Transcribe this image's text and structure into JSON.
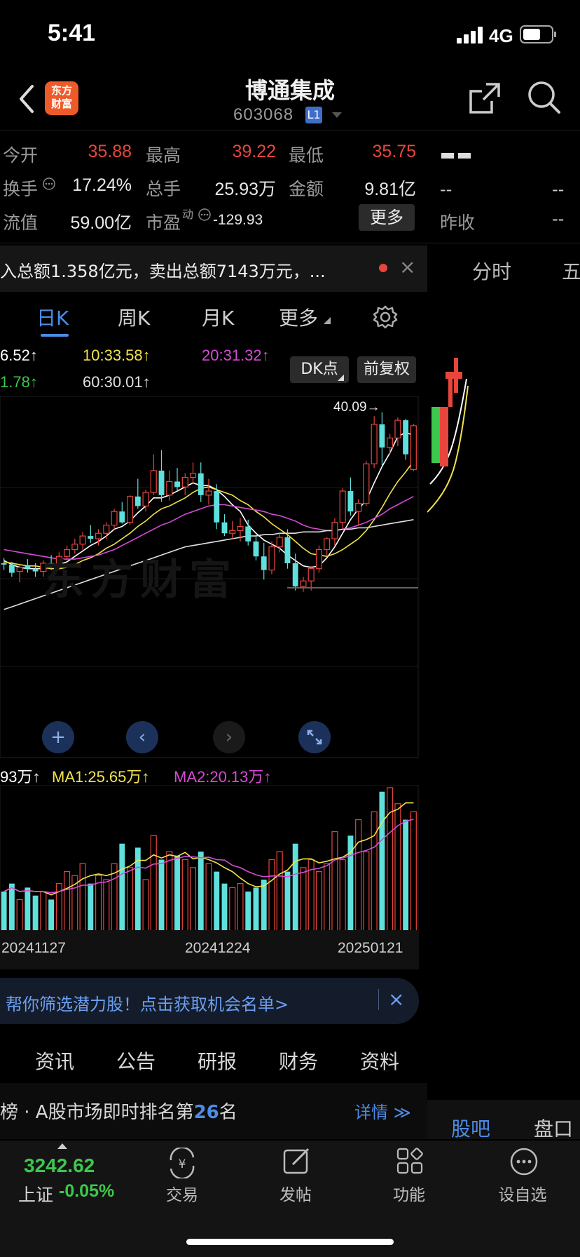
{
  "status": {
    "time": "5:41",
    "network": "4G"
  },
  "header": {
    "title": "博通集成",
    "code": "603068",
    "level": "L1"
  },
  "quote": {
    "row1": [
      {
        "label": "今开",
        "value": "35.88"
      },
      {
        "label": "最高",
        "value": "39.22"
      },
      {
        "label": "最低",
        "value": "35.75"
      }
    ],
    "row2": [
      {
        "label": "换手",
        "value": "17.24%"
      },
      {
        "label": "总手",
        "value": "25.93万"
      },
      {
        "label": "金额",
        "value": "9.81亿"
      }
    ],
    "row3": [
      {
        "label": "流值",
        "value": "59.00亿"
      },
      {
        "label": "市盈",
        "sup": "动",
        "value": "-129.93"
      }
    ],
    "more": "更多",
    "side": {
      "dashes": "--",
      "prev_close_label": "昨收",
      "prev_close_value": "--"
    }
  },
  "ticker": {
    "text": "入总额1.358亿元，卖出总额7143万元，...",
    "close": "×"
  },
  "kline_tabs": [
    "日K",
    "周K",
    "月K",
    "更多"
  ],
  "right_tabs": {
    "fen_shi": "分时",
    "wu": "五",
    "guba": "股吧",
    "pankou": "盘口"
  },
  "ma_labels": {
    "ma5": "6.52↑",
    "ma10": "10:33.58↑",
    "ma20": "20:31.32↑",
    "ma30": "1.78↑",
    "ma60": "60:30.01↑"
  },
  "buttons": {
    "dk": "DK点",
    "fuquan": "前复权"
  },
  "annotations": {
    "high_marker": "40.09→"
  },
  "volume_labels": {
    "vol": "93万↑",
    "ma1": "MA1:25.65万↑",
    "ma2": "MA2:20.13万↑"
  },
  "dates": [
    "20241127",
    "20241224",
    "20250121"
  ],
  "promo": {
    "text": "帮你筛选潜力股！点击获取机会名单>",
    "close": "×"
  },
  "section_tabs": [
    "资讯",
    "公告",
    "研报",
    "财务",
    "资料"
  ],
  "rank": {
    "prefix": "榜 · A股市场即时排名第",
    "number": "26",
    "suffix": "名",
    "detail": "详情 ≫"
  },
  "bottom": {
    "index_value": "3242.62",
    "index_name": "上证",
    "index_change": "-0.05%",
    "items": [
      "交易",
      "发帖",
      "功能",
      "设自选"
    ]
  },
  "colors": {
    "up": "#e8453c",
    "down": "#5fe0dc",
    "ma5": "#ffffff",
    "ma10": "#f2e34b",
    "ma20": "#d64bd8",
    "ma30": "#3cc84c",
    "ma60": "#e0e0e0",
    "accent": "#4d8be6"
  },
  "chart_data": {
    "type": "candlestick",
    "x_ticks": [
      "20241127",
      "20241224",
      "20250121"
    ],
    "ohlc": [
      [
        29.0,
        29.4,
        28.5,
        28.9
      ],
      [
        28.9,
        29.1,
        28.0,
        28.3
      ],
      [
        28.4,
        28.9,
        27.6,
        28.7
      ],
      [
        28.8,
        29.3,
        28.3,
        28.6
      ],
      [
        28.6,
        29.0,
        28.0,
        28.4
      ],
      [
        28.4,
        29.2,
        28.0,
        29.0
      ],
      [
        29.0,
        29.6,
        28.5,
        28.8
      ],
      [
        28.8,
        29.8,
        28.5,
        29.5
      ],
      [
        29.5,
        30.3,
        29.2,
        30.0
      ],
      [
        30.0,
        30.8,
        29.7,
        30.4
      ],
      [
        30.4,
        31.3,
        30.0,
        31.0
      ],
      [
        31.0,
        31.8,
        30.5,
        30.8
      ],
      [
        30.8,
        31.5,
        30.3,
        31.2
      ],
      [
        31.2,
        32.0,
        30.8,
        31.8
      ],
      [
        31.8,
        33.0,
        31.5,
        32.8
      ],
      [
        32.8,
        33.5,
        31.9,
        32.0
      ],
      [
        32.0,
        34.0,
        31.8,
        33.9
      ],
      [
        33.9,
        35.2,
        33.0,
        33.2
      ],
      [
        33.2,
        34.4,
        32.8,
        34.2
      ],
      [
        34.2,
        37.0,
        34.0,
        35.8
      ],
      [
        35.8,
        37.3,
        33.5,
        34.0
      ],
      [
        34.0,
        35.8,
        33.6,
        35.0
      ],
      [
        35.0,
        36.0,
        34.3,
        34.6
      ],
      [
        34.6,
        35.6,
        34.0,
        35.3
      ],
      [
        35.3,
        36.4,
        34.8,
        35.6
      ],
      [
        35.6,
        36.4,
        33.5,
        34.0
      ],
      [
        34.0,
        35.2,
        33.3,
        34.3
      ],
      [
        34.3,
        34.8,
        31.5,
        32.0
      ],
      [
        32.0,
        32.6,
        31.0,
        31.2
      ],
      [
        31.2,
        32.1,
        30.8,
        31.4
      ],
      [
        31.4,
        32.3,
        30.6,
        31.7
      ],
      [
        31.7,
        32.2,
        30.3,
        30.6
      ],
      [
        30.6,
        31.1,
        29.2,
        29.5
      ],
      [
        29.5,
        30.5,
        27.8,
        28.5
      ],
      [
        28.5,
        30.6,
        28.2,
        30.2
      ],
      [
        30.2,
        31.2,
        29.8,
        30.9
      ],
      [
        30.9,
        31.5,
        28.6,
        29.0
      ],
      [
        29.0,
        29.7,
        27.0,
        27.3
      ],
      [
        27.3,
        28.0,
        26.9,
        27.7
      ],
      [
        27.7,
        28.8,
        27.0,
        28.6
      ],
      [
        28.6,
        30.3,
        28.3,
        30.0
      ],
      [
        30.0,
        30.9,
        29.5,
        30.8
      ],
      [
        30.8,
        32.3,
        30.3,
        32.0
      ],
      [
        32.0,
        34.5,
        31.5,
        34.3
      ],
      [
        34.3,
        35.3,
        32.5,
        32.8
      ],
      [
        32.8,
        33.7,
        31.8,
        33.4
      ],
      [
        33.4,
        36.5,
        33.2,
        36.3
      ],
      [
        36.3,
        39.8,
        36.0,
        39.2
      ],
      [
        39.2,
        40.09,
        36.2,
        37.5
      ],
      [
        37.5,
        38.5,
        37.0,
        38.2
      ],
      [
        38.2,
        39.7,
        37.6,
        39.5
      ],
      [
        39.5,
        39.6,
        36.6,
        37.0
      ],
      [
        35.88,
        39.22,
        35.75,
        39.1
      ]
    ],
    "ma_series": [
      {
        "name": "MA5",
        "values": [
          29.2,
          28.9,
          28.7,
          28.6,
          28.6,
          28.6,
          28.7,
          28.9,
          29.1,
          29.5,
          29.9,
          30.3,
          30.6,
          31.0,
          31.5,
          31.7,
          32.1,
          32.7,
          33.2,
          33.8,
          33.8,
          34.0,
          34.3,
          34.6,
          34.9,
          34.7,
          34.7,
          34.4,
          33.9,
          33.3,
          32.8,
          31.8,
          31.2,
          30.7,
          30.4,
          30.1,
          29.6,
          29.2,
          28.8,
          28.7,
          28.8,
          29.4,
          30.2,
          31.2,
          32.2,
          33.0,
          33.6,
          34.9,
          36.1,
          37.1,
          38.3,
          38.6,
          38.4
        ]
      },
      {
        "name": "MA10",
        "values": [
          29.1,
          29.0,
          28.9,
          28.8,
          28.8,
          28.7,
          28.6,
          28.6,
          28.7,
          28.9,
          29.2,
          29.4,
          29.7,
          30.1,
          30.4,
          30.8,
          31.2,
          31.7,
          32.1,
          32.6,
          33.0,
          33.2,
          33.5,
          33.8,
          34.2,
          34.5,
          34.6,
          34.4,
          34.2,
          34.0,
          33.6,
          33.3,
          32.8,
          32.4,
          31.9,
          31.5,
          31.1,
          30.6,
          30.1,
          29.7,
          29.6,
          29.5,
          29.7,
          30.0,
          30.4,
          30.8,
          31.4,
          32.2,
          33.1,
          34.1,
          35.0,
          35.7,
          36.5
        ]
      },
      {
        "name": "MA20",
        "values": [
          30.0,
          29.9,
          29.8,
          29.7,
          29.6,
          29.5,
          29.4,
          29.3,
          29.3,
          29.3,
          29.4,
          29.5,
          29.6,
          29.8,
          30.0,
          30.3,
          30.6,
          30.9,
          31.2,
          31.5,
          31.8,
          32.0,
          32.3,
          32.6,
          32.8,
          33.0,
          33.2,
          33.3,
          33.3,
          33.2,
          33.1,
          33.0,
          32.9,
          32.8,
          32.6,
          32.5,
          32.3,
          32.1,
          31.8,
          31.6,
          31.5,
          31.4,
          31.4,
          31.5,
          31.6,
          31.8,
          32.0,
          32.3,
          32.6,
          33.0,
          33.3,
          33.6,
          33.9
        ]
      },
      {
        "name": "MA60",
        "values": [
          25.6,
          25.8,
          26.0,
          26.2,
          26.4,
          26.6,
          26.8,
          27.0,
          27.2,
          27.4,
          27.6,
          27.8,
          28.0,
          28.2,
          28.4,
          28.6,
          28.8,
          29.0,
          29.2,
          29.4,
          29.6,
          29.8,
          30.0,
          30.2,
          30.3,
          30.4,
          30.5,
          30.6,
          30.7,
          30.8,
          30.9,
          31.0,
          31.0,
          31.1,
          31.1,
          31.2,
          31.2,
          31.2,
          31.3,
          31.3,
          31.3,
          31.4,
          31.4,
          31.5,
          31.5,
          31.6,
          31.6,
          31.7,
          31.8,
          31.9,
          32.0,
          32.1,
          32.2
        ]
      }
    ],
    "volume": [
      10,
      12,
      8,
      11,
      9,
      10,
      8,
      12,
      15,
      14,
      17,
      12,
      14,
      13,
      17,
      22,
      16,
      21,
      13,
      24,
      18,
      20,
      19,
      18,
      16,
      20,
      17,
      15,
      12,
      11,
      12,
      10,
      11,
      13,
      18,
      20,
      15,
      22,
      16,
      18,
      15,
      17,
      25,
      18,
      24,
      28,
      20,
      30,
      35,
      36,
      32,
      28,
      30
    ]
  }
}
